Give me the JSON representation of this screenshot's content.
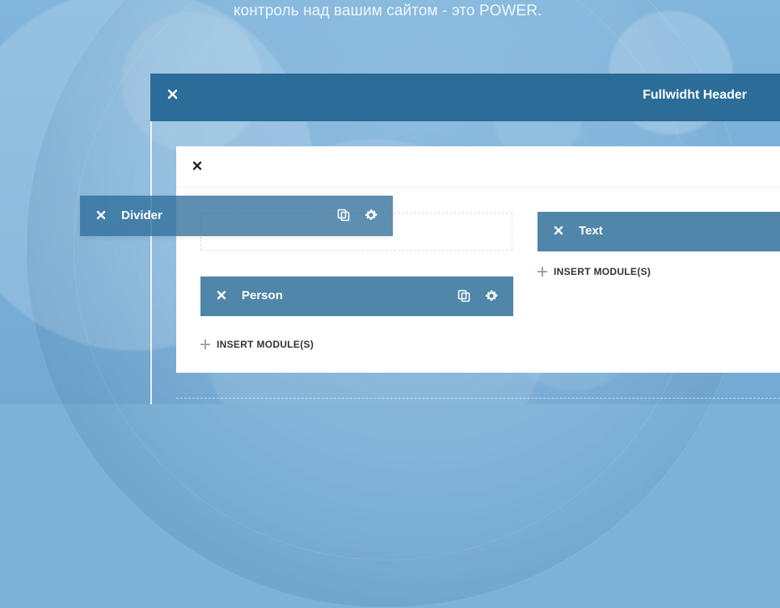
{
  "hero": {
    "subtitle": "контроль над вашим сайтом - это POWER."
  },
  "fullwidth_header": {
    "title": "Fullwidht Header"
  },
  "drag_module": {
    "label": "Divider"
  },
  "modules": {
    "person": {
      "label": "Person"
    },
    "text": {
      "label": "Text"
    }
  },
  "actions": {
    "insert_left": "INSERT MODULE(S)",
    "insert_right": "INSERT MODULE(S)"
  },
  "icons": {
    "close": "close-icon",
    "duplicate": "duplicate-icon",
    "settings": "gear-icon",
    "plus": "plus-icon"
  },
  "colors": {
    "header_blue": "#2b6c98",
    "module_blue": "#4f86a9",
    "background_blue": "#7db2d8",
    "white": "#ffffff",
    "text_dark": "#333333"
  }
}
